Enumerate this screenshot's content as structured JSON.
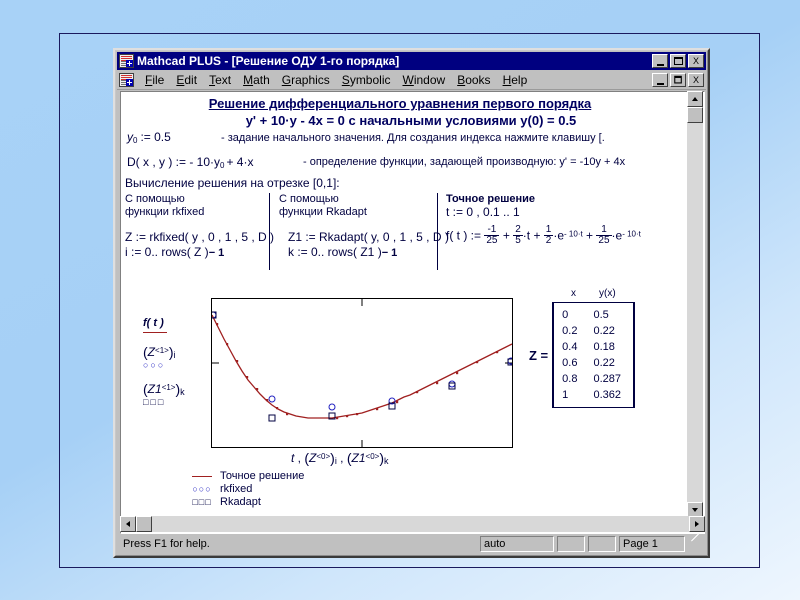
{
  "window": {
    "title": "Mathcad PLUS - [Решение ОДУ 1-го порядка]",
    "app_icon": "mathcad-document-icon",
    "buttons": {
      "minimize": "minimize-button",
      "maximize": "maximize-button",
      "close": "X"
    },
    "child_buttons": {
      "minimize": "minimize-button",
      "restore": "restore-button",
      "close": "X"
    }
  },
  "menu": {
    "items": [
      {
        "label": "File",
        "mnemonic": "F"
      },
      {
        "label": "Edit",
        "mnemonic": "E"
      },
      {
        "label": "Text",
        "mnemonic": "T"
      },
      {
        "label": "Math",
        "mnemonic": "M"
      },
      {
        "label": "Graphics",
        "mnemonic": "G"
      },
      {
        "label": "Symbolic",
        "mnemonic": "S"
      },
      {
        "label": "Window",
        "mnemonic": "W"
      },
      {
        "label": "Books",
        "mnemonic": "B"
      },
      {
        "label": "Help",
        "mnemonic": "H"
      }
    ]
  },
  "statusbar": {
    "help": "Press F1 for help.",
    "mode": "auto",
    "field2": "",
    "field3": "",
    "page": "Page 1"
  },
  "worksheet": {
    "heading1": "Решение дифференциального уравнения первого порядка",
    "heading2": "y' + 10·y - 4x = 0 с начальными условиями y(0) = 0.5",
    "y0_assign": "y",
    "y0_sub": "0",
    "y0_value": ":= 0.5",
    "y0_comment": "- задание начального значения. Для создания индекса нажмите  клавишу [.",
    "d_def": "D( x , y ) := - 10·y",
    "d_def_sub": "0",
    "d_def_tail": "+ 4·x",
    "d_comment": "- определение функции, задающей производную: y' = -10y + 4x",
    "section_label": "Вычисление решения на отрезке [0,1]:",
    "columns": [
      {
        "title_line1": "С помощью",
        "title_line2": "функции rkfixed",
        "expr1": "Z := rkfixed( y , 0 , 1 , 5 , D )",
        "expr2_pre": "i := 0.. rows( Z )",
        "expr2_post": "− 1"
      },
      {
        "title_line1": "С помощью",
        "title_line2": "функции Rkadapt",
        "expr1": "Z1 := Rkadapt( y, 0 , 1 , 5 , D )",
        "expr2_pre": "k := 0.. rows( Z1 )",
        "expr2_post": "− 1"
      },
      {
        "title_line1": "Точное решение",
        "title_line2": "t := 0 , 0.1 .. 1",
        "formula_lead": "f( t ) :=",
        "terms": [
          {
            "num": "-1",
            "den": "25"
          },
          {
            "num": "2",
            "den": "5",
            "suffix": "·t"
          },
          {
            "num": "1",
            "den": "2",
            "suffix": "·e",
            "exp": "- 10·t"
          },
          {
            "num": "1",
            "den": "25",
            "suffix": "·e",
            "exp": "- 10·t"
          }
        ]
      }
    ],
    "plot": {
      "legend_exact_label": "f( t )",
      "legend_series2": "( Z<1> )i",
      "legend_series3": "( Z1<1> )k",
      "xaxis_label": "t , ( Z<0> )i , ( Z1<0> )k"
    },
    "plot_legend_bottom": [
      {
        "key": "solid-line",
        "label": "Точное решение"
      },
      {
        "key": "circle-markers",
        "label": "rkfixed"
      },
      {
        "key": "square-markers",
        "label": "Rkadapt"
      }
    ],
    "matrix": {
      "name": "Z =",
      "headers": [
        "x",
        "y(x)"
      ],
      "rows": [
        [
          "0",
          "0.5"
        ],
        [
          "0.2",
          "0.22"
        ],
        [
          "0.4",
          "0.18"
        ],
        [
          "0.6",
          "0.22"
        ],
        [
          "0.8",
          "0.287"
        ],
        [
          "1",
          "0.362"
        ]
      ]
    }
  },
  "colors": {
    "titlebar": "#000080",
    "face": "#c0c0c0",
    "math_ink": "#000040",
    "exact_curve": "#a02020",
    "circle_marker": "#2020c0",
    "square_marker": "#000040",
    "slide_bg": "#a8d2f7",
    "frame_border": "#1a1a5e"
  },
  "chart_data": {
    "type": "line",
    "title": "",
    "xlabel": "t , (Z<0>)i , (Z1<0>)k",
    "ylabel": "",
    "xlim": [
      0,
      1
    ],
    "ylim": [
      0.1,
      0.55
    ],
    "grid": false,
    "legend_position": "left",
    "xticks": [
      0.5
    ],
    "yticks": [
      0.3
    ],
    "series": [
      {
        "name": "Точное решение",
        "type": "line",
        "color": "#a02020",
        "x": [
          0,
          0.1,
          0.2,
          0.3,
          0.4,
          0.5,
          0.6,
          0.7,
          0.8,
          0.9,
          1
        ],
        "y": [
          0.5,
          0.264,
          0.189,
          0.171,
          0.18,
          0.202,
          0.23,
          0.262,
          0.296,
          0.33,
          0.364
        ]
      },
      {
        "name": "rkfixed",
        "type": "scatter",
        "marker": "circle",
        "color": "#2020c0",
        "x": [
          0,
          0.2,
          0.4,
          0.6,
          0.8,
          1
        ],
        "y": [
          0.5,
          0.246,
          0.222,
          0.238,
          0.289,
          0.362
        ]
      },
      {
        "name": "Rkadapt",
        "type": "scatter",
        "marker": "square",
        "color": "#000040",
        "x": [
          0,
          0.2,
          0.4,
          0.6,
          0.8,
          1
        ],
        "y": [
          0.5,
          0.18,
          0.186,
          0.228,
          0.287,
          0.362
        ]
      }
    ]
  }
}
